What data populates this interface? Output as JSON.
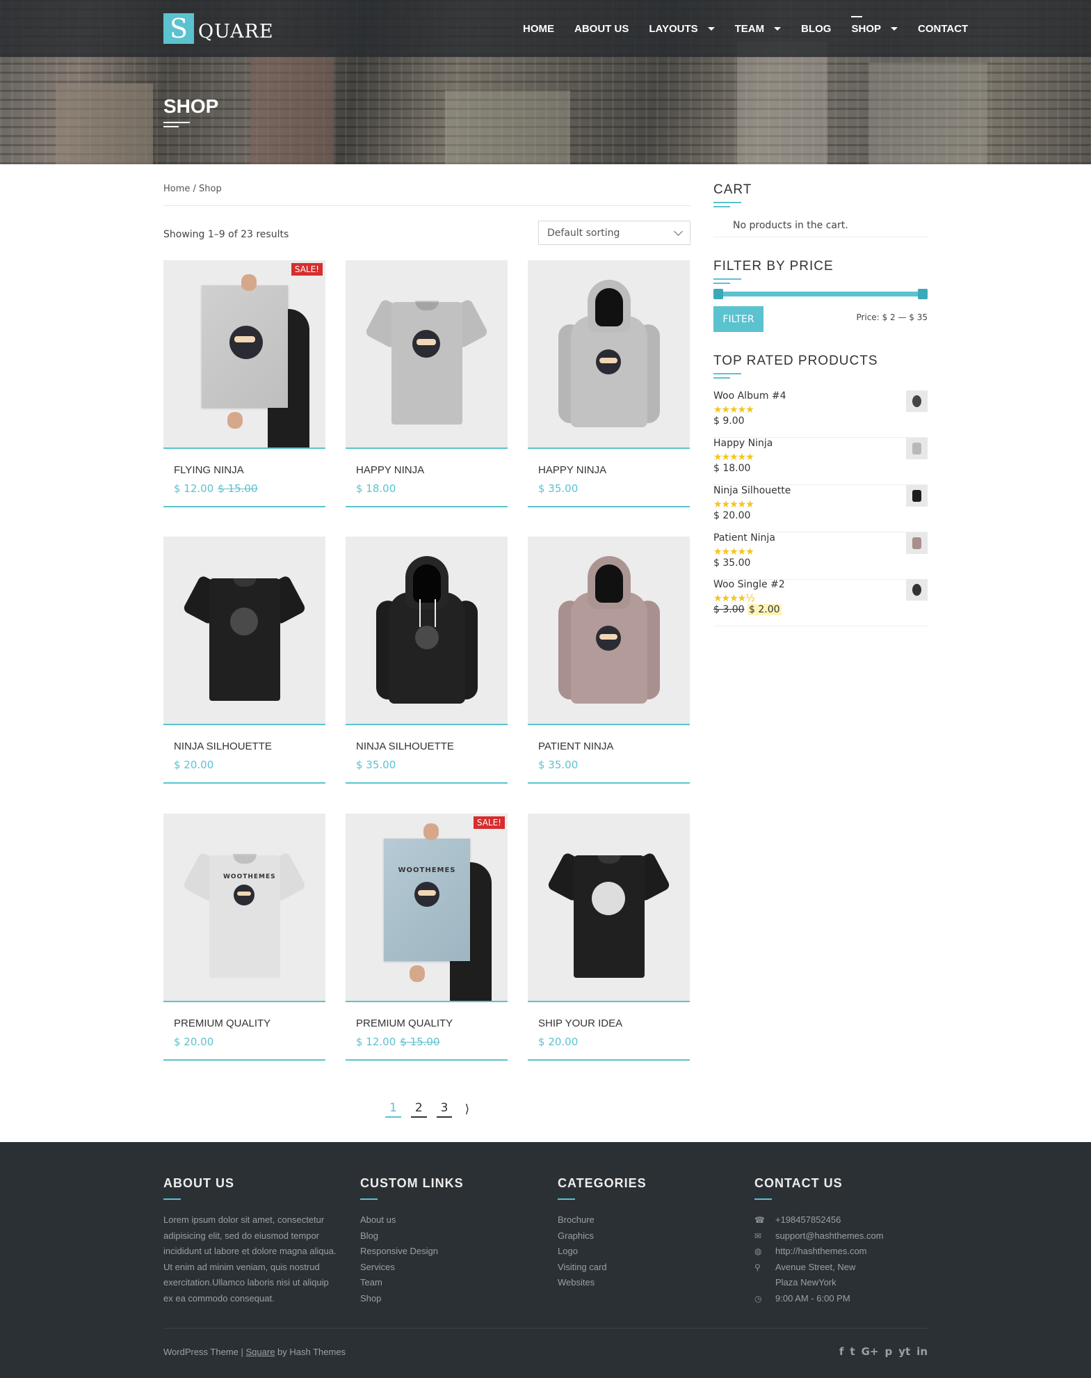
{
  "header": {
    "logo_letter": "S",
    "logo_text": "QUARE",
    "nav": [
      {
        "label": "HOME",
        "dropdown": false
      },
      {
        "label": "ABOUT US",
        "dropdown": false
      },
      {
        "label": "LAYOUTS",
        "dropdown": true
      },
      {
        "label": "TEAM",
        "dropdown": true
      },
      {
        "label": "BLOG",
        "dropdown": false
      },
      {
        "label": "SHOP",
        "dropdown": true,
        "active": true
      },
      {
        "label": "CONTACT",
        "dropdown": false
      }
    ],
    "page_title": "SHOP"
  },
  "breadcrumb": "Home / Shop",
  "shop": {
    "results_text": "Showing 1–9 of 23 results",
    "sorting": "Default sorting",
    "products": [
      {
        "name": "FLYING NINJA",
        "price": "$ 12.00",
        "old_price": "$ 15.00",
        "sale": "SALE!"
      },
      {
        "name": "HAPPY NINJA",
        "price": "$ 18.00"
      },
      {
        "name": "HAPPY NINJA",
        "price": "$ 35.00"
      },
      {
        "name": "NINJA SILHOUETTE",
        "price": "$ 20.00"
      },
      {
        "name": "NINJA SILHOUETTE",
        "price": "$ 35.00"
      },
      {
        "name": "PATIENT NINJA",
        "price": "$ 35.00"
      },
      {
        "name": "PREMIUM QUALITY",
        "price": "$ 20.00"
      },
      {
        "name": "PREMIUM QUALITY",
        "price": "$ 12.00",
        "old_price": "$ 15.00",
        "sale": "SALE!"
      },
      {
        "name": "SHIP YOUR IDEA",
        "price": "$ 20.00"
      }
    ],
    "pagination": {
      "pages": [
        "1",
        "2",
        "3"
      ],
      "current": "1",
      "next": "⟩"
    }
  },
  "sidebar": {
    "cart_title": "CART",
    "cart_empty": "No products in the cart.",
    "filter_title": "FILTER BY PRICE",
    "filter_button": "FILTER",
    "price_label": "Price: $ 2 — $ 35",
    "top_rated_title": "TOP RATED PRODUCTS",
    "top_rated": [
      {
        "name": "Woo Album #4",
        "price": "$ 9.00",
        "rating": 5,
        "stars": "★★★★★"
      },
      {
        "name": "Happy Ninja",
        "price": "$ 18.00",
        "rating": 5,
        "stars": "★★★★★"
      },
      {
        "name": "Ninja Silhouette",
        "price": "$ 20.00",
        "rating": 5,
        "stars": "★★★★★"
      },
      {
        "name": "Patient Ninja",
        "price": "$ 35.00",
        "rating": 5,
        "stars": "★★★★★"
      },
      {
        "name": "Woo Single #2",
        "old_price": "$ 3.00",
        "price": "$ 2.00",
        "rating": 4.5,
        "stars": "★★★★½"
      }
    ]
  },
  "footer": {
    "about_title": "ABOUT US",
    "about_text": "Lorem ipsum dolor sit amet, consectetur adipisicing elit, sed do eiusmod tempor incididunt ut labore et dolore magna aliqua. Ut enim ad minim veniam, quis nostrud exercitation.Ullamco laboris nisi ut aliquip ex ea commodo consequat.",
    "links_title": "CUSTOM LINKS",
    "links": [
      "About us",
      "Blog",
      "Responsive Design",
      "Services",
      "Team",
      "Shop"
    ],
    "categories_title": "CATEGORIES",
    "categories": [
      "Brochure",
      "Graphics",
      "Logo",
      "Visiting card",
      "Websites"
    ],
    "contact_title": "CONTACT US",
    "contact": [
      {
        "icon": "phone-icon",
        "text": "+198457852456"
      },
      {
        "icon": "envelope-icon",
        "text": "support@hashthemes.com"
      },
      {
        "icon": "globe-icon",
        "text": "http://hashthemes.com"
      },
      {
        "icon": "map-marker-icon",
        "text": "Avenue Street, New Plaza NewYork"
      },
      {
        "icon": "clock-icon",
        "text": "9:00 AM - 6:00 PM"
      }
    ],
    "credits_prefix": "WordPress Theme | ",
    "credits_link": "Square",
    "credits_suffix": " by Hash Themes",
    "social": [
      "f",
      "t",
      "G+",
      "p",
      "yt",
      "in"
    ]
  },
  "colors": {
    "accent": "#5bc2cf",
    "sale": "#d62e2e",
    "footer_bg": "#2b3034",
    "star": "#f5c518"
  }
}
